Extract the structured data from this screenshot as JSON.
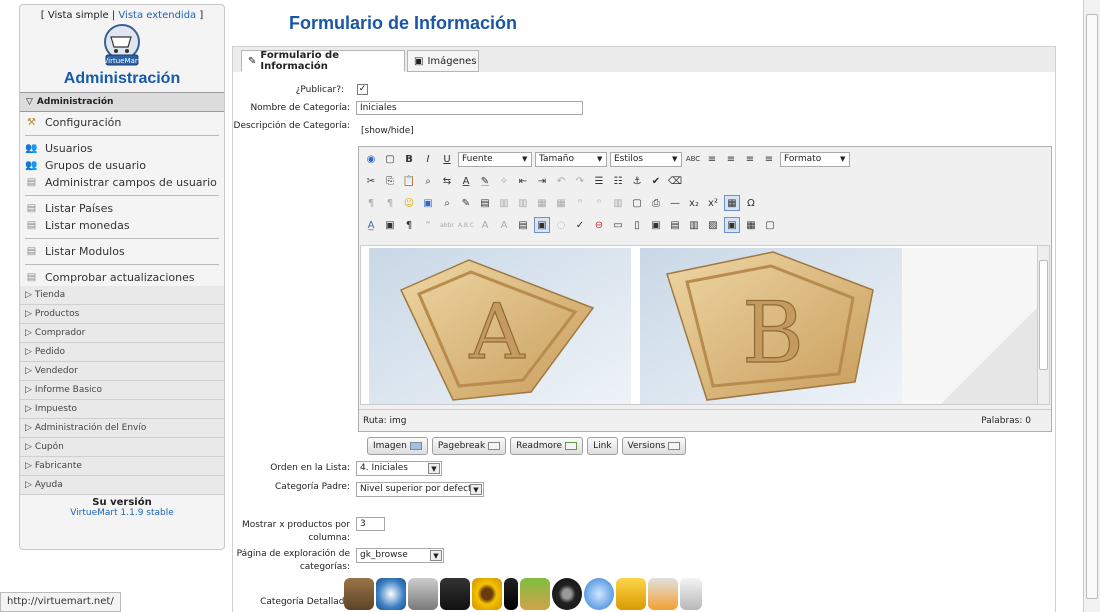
{
  "sidebar": {
    "view_simple": "Vista simple",
    "view_extended": "Vista extendida",
    "logo_text": "VirtueMart",
    "title": "Administración",
    "section_open": "Administración",
    "items": [
      {
        "label": "Configuración",
        "icon": "wrench-icon"
      },
      {
        "label": "Usuarios",
        "icon": "users-icon"
      },
      {
        "label": "Grupos de usuario",
        "icon": "users-icon"
      },
      {
        "label": "Administrar campos de usuario",
        "icon": "fields-icon"
      },
      {
        "label": "Listar Países",
        "icon": "list-icon"
      },
      {
        "label": "Listar monedas",
        "icon": "list-icon"
      },
      {
        "label": "Listar Modulos",
        "icon": "list-icon"
      },
      {
        "label": "Comprobar actualizaciones",
        "icon": "list-icon"
      }
    ],
    "collapsed": [
      "Tienda",
      "Productos",
      "Comprador",
      "Pedido",
      "Vendedor",
      "Informe Basico",
      "Impuesto",
      "Administración del Envío",
      "Cupón",
      "Fabricante",
      "Ayuda"
    ],
    "version_label": "Su versión",
    "version": "VirtueMart 1.1.9 stable"
  },
  "statusbar": "http://virtuemart.net/",
  "page_title": "Formulario de Información",
  "tabs": [
    {
      "label": "Formulario de Información",
      "icon": "edit-form-icon"
    },
    {
      "label": "Imágenes",
      "icon": "image-icon"
    }
  ],
  "form": {
    "publish_label": "¿Publicar?:",
    "publish_checked": "✓",
    "name_label": "Nombre de Categoría:",
    "name_value": "Iniciales",
    "desc_label": "Descripción de Categoría:",
    "showhide": "[show/hide]",
    "order_label": "Orden en la Lista:",
    "order_value": "4. Iniciales",
    "parent_label": "Categoría Padre:",
    "parent_value": "Nivel superior por defecto",
    "products_label_1": "Mostrar x productos por",
    "products_label_2": "columna:",
    "products_value": "3",
    "browse_label_1": "Página de exploración de",
    "browse_label_2": "categorías:",
    "browse_value": "gk_browse",
    "detail_label": "Categoría Detallada"
  },
  "editor": {
    "font": "Fuente",
    "size": "Tamaño",
    "styles": "Estilos",
    "format": "Formato",
    "path": "Ruta: img",
    "words": "Palabras: 0",
    "buttons": [
      "Imagen",
      "Pagebreak",
      "Readmore",
      "Link",
      "Versions"
    ]
  },
  "colors": {
    "title": "#1a56a4",
    "link": "#1b63b7",
    "wood": "#d9b477"
  }
}
